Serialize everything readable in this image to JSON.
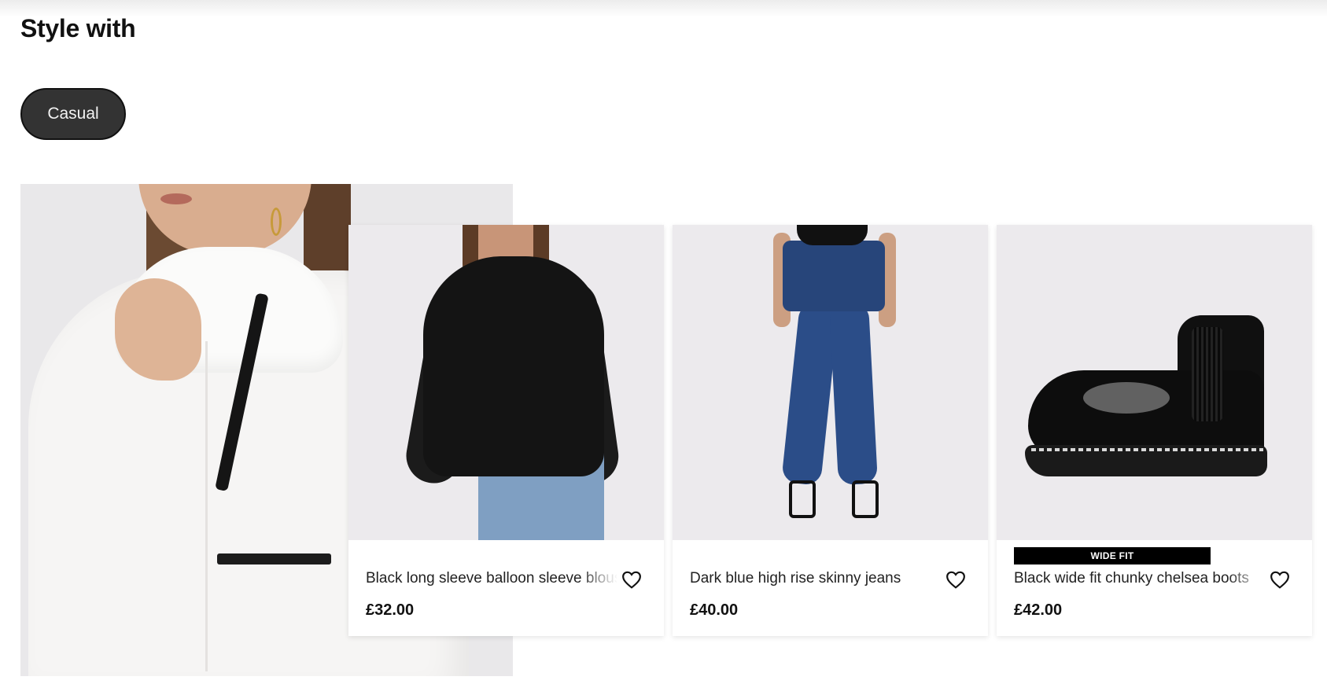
{
  "section": {
    "title": "Style with"
  },
  "filter": {
    "chip_label": "Casual"
  },
  "products": [
    {
      "name": "Black long sleeve balloon sleeve blouse",
      "price": "£32.00",
      "badge": "",
      "favourite_icon": "heart-outline-icon"
    },
    {
      "name": "Dark blue high rise skinny jeans",
      "price": "£40.00",
      "badge": "",
      "favourite_icon": "heart-outline-icon"
    },
    {
      "name": "Black wide fit chunky chelsea boots",
      "price": "£42.00",
      "badge": "WIDE FIT",
      "favourite_icon": "heart-outline-icon"
    }
  ],
  "colors": {
    "chip_bg": "#333333",
    "badge_bg": "#000000",
    "page_bg": "#ffffff",
    "image_bg": "#eceaed"
  }
}
